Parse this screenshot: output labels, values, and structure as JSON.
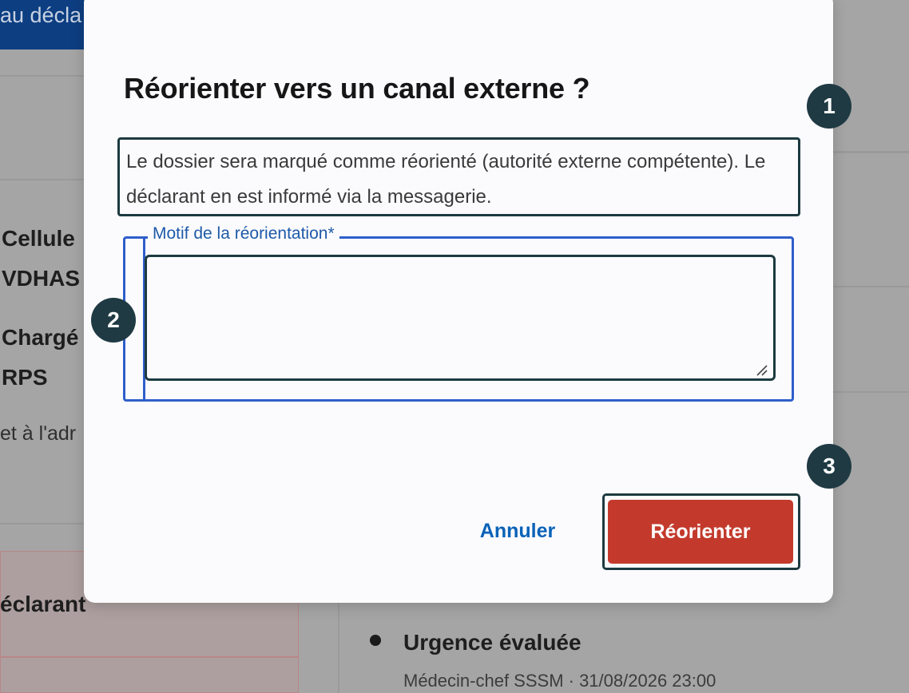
{
  "background": {
    "top_button_label": "au décla",
    "labels": [
      "Cellule",
      "VDHAS",
      "Chargé",
      "RPS"
    ],
    "muted_label": "et à l'adr",
    "declarant_label": "éclarant",
    "timeline": {
      "title": "Urgence évaluée",
      "meta": "Médecin-chef SSSM · 31/08/2026 23:00"
    }
  },
  "modal": {
    "title": "Réorienter vers un canal externe ?",
    "description": "Le dossier sera marqué comme réorienté (autorité externe compétente). Le déclarant en est informé via la messagerie.",
    "field": {
      "legend": "Motif de la réorientation*",
      "value": ""
    },
    "cancel_label": "Annuler",
    "confirm_label": "Réorienter"
  },
  "annotations": [
    "1",
    "2",
    "3"
  ],
  "colors": {
    "primary_button": "#c33a2c",
    "link": "#0a62b8",
    "focus_outline": "#1c3a40",
    "fieldset_border": "#2f5ecb",
    "badge": "#1f3a43"
  }
}
